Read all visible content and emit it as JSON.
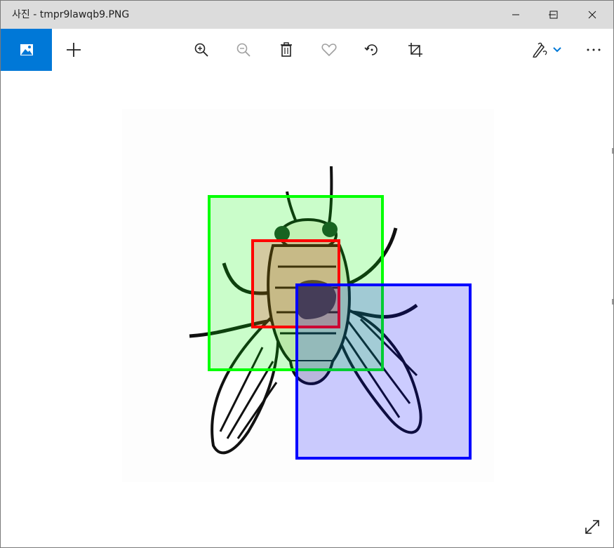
{
  "window": {
    "title": "사진 - tmpr9lawqb9.PNG",
    "controls": [
      "minimize",
      "maximize",
      "close"
    ]
  },
  "toolbar": {
    "photo_tile_icon": "photo-icon",
    "add_icon": "plus-icon",
    "tools": [
      "zoom-in-icon",
      "zoom-out-icon",
      "delete-icon",
      "favorite-heart-icon",
      "rotate-icon",
      "crop-icon"
    ],
    "edit_icon": "edit-draw-icon",
    "more_icon": "more-icon"
  },
  "image": {
    "subject": "insect",
    "boxes": [
      {
        "name": "green-box",
        "color": "#00ff00",
        "fill": "rgba(0,255,0,0.2)"
      },
      {
        "name": "red-box",
        "color": "#ff0000",
        "fill": "rgba(255,0,0,0.2)"
      },
      {
        "name": "blue-box",
        "color": "#0000ff",
        "fill": "rgba(0,0,255,0.2)"
      }
    ]
  },
  "colors": {
    "accent": "#0078d7",
    "titlebar": "#dcdcdc"
  },
  "footer": {
    "expand_icon": "expand-icon"
  }
}
